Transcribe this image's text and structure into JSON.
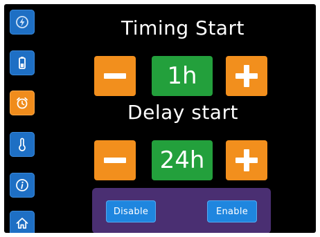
{
  "sidebar": {
    "items": [
      {
        "icon": "power-bolt-icon",
        "active": false
      },
      {
        "icon": "battery-icon",
        "active": false
      },
      {
        "icon": "alarm-clock-icon",
        "active": true
      },
      {
        "icon": "thermometer-icon",
        "active": false
      },
      {
        "icon": "info-icon",
        "active": false
      },
      {
        "icon": "home-icon",
        "active": false
      }
    ]
  },
  "timing": {
    "title": "Timing Start",
    "value": "1h"
  },
  "delay": {
    "title": "Delay start",
    "value": "24h"
  },
  "mode": {
    "disable_label": "Disable",
    "enable_label": "Enable"
  },
  "colors": {
    "background": "#000000",
    "sidebar_button": "#1e6fc4",
    "sidebar_active": "#f08c1c",
    "stepper": "#f28f1d",
    "value_box": "#23a03c",
    "panel": "#4a2f72",
    "toggle_button": "#1f86df"
  }
}
